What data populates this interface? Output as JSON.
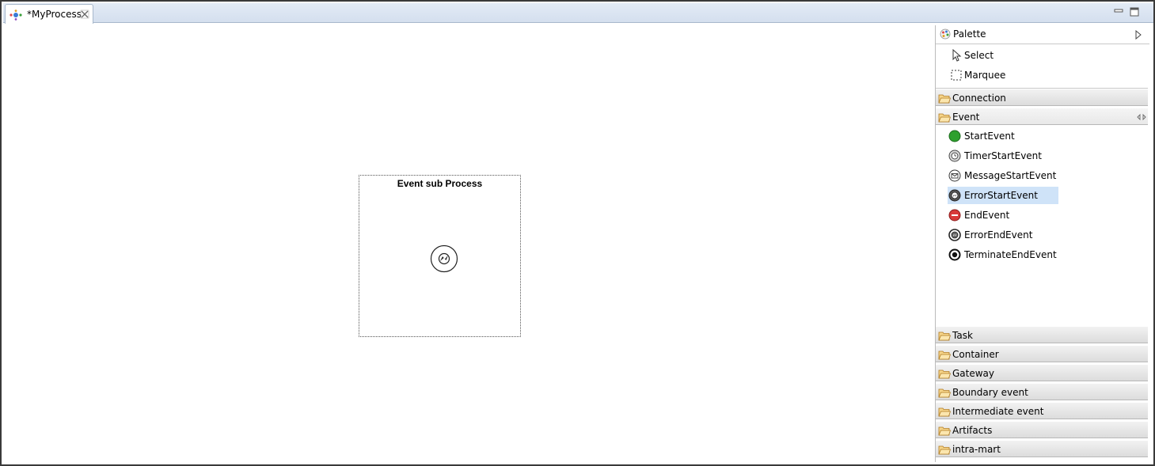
{
  "editor": {
    "tab_title": "*MyProcess"
  },
  "canvas": {
    "subprocess_label": "Event sub Process",
    "node_icon": "error-start-event-icon"
  },
  "palette": {
    "title": "Palette",
    "tools": [
      {
        "label": "Select",
        "icon": "arrow-cursor-icon"
      },
      {
        "label": "Marquee",
        "icon": "marquee-icon"
      }
    ],
    "drawers": {
      "connection": "Connection",
      "event": "Event",
      "task": "Task",
      "container": "Container",
      "gateway": "Gateway",
      "boundary_event": "Boundary event",
      "intermediate_event": "Intermediate event",
      "artifacts": "Artifacts",
      "intra_mart": "intra-mart"
    },
    "event_entries": [
      {
        "label": "StartEvent",
        "icon": "start-event-icon"
      },
      {
        "label": "TimerStartEvent",
        "icon": "timer-start-event-icon"
      },
      {
        "label": "MessageStartEvent",
        "icon": "message-start-event-icon"
      },
      {
        "label": "ErrorStartEvent",
        "icon": "error-start-event-icon",
        "selected": true
      },
      {
        "label": "EndEvent",
        "icon": "end-event-icon"
      },
      {
        "label": "ErrorEndEvent",
        "icon": "error-end-event-icon"
      },
      {
        "label": "TerminateEndEvent",
        "icon": "terminate-end-event-icon"
      }
    ]
  },
  "colors": {
    "tab_bar": "#d4dfee",
    "selection": "#cfe3f8",
    "folder": "#e8a33a",
    "start_green": "#2ea02e",
    "end_red": "#d83a3a"
  }
}
